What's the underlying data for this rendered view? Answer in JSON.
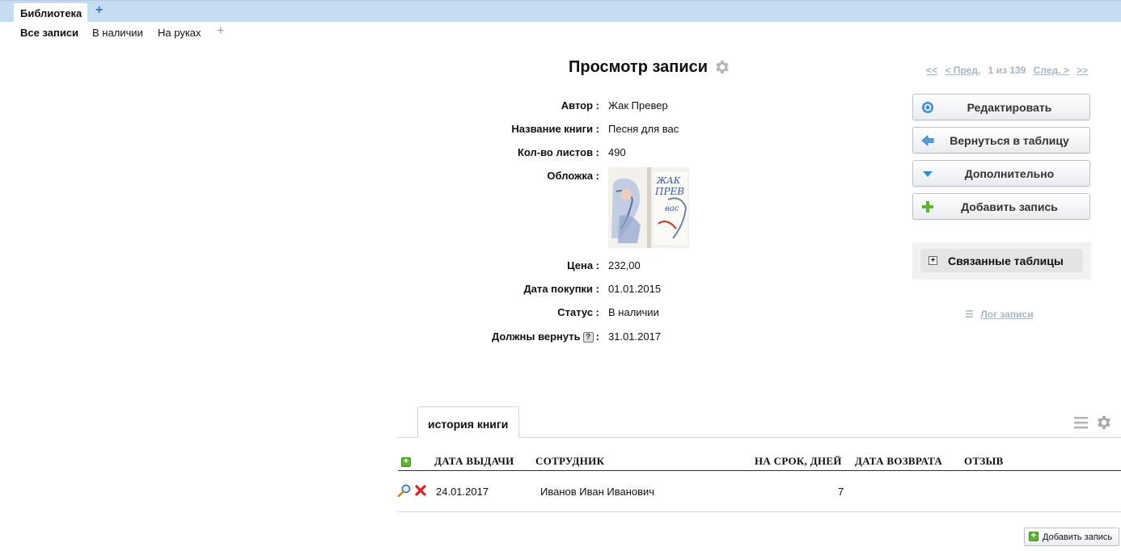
{
  "topbar": {
    "tab_label": "Библиотека",
    "add_label": "+"
  },
  "subnav": {
    "items": [
      "Все записи",
      "В наличии",
      "На руках"
    ],
    "add_label": "+"
  },
  "page": {
    "title": "Просмотр записи"
  },
  "pager": {
    "first": "<<",
    "prev": "< Пред.",
    "info": "1 из 139",
    "next": "След. >",
    "last": ">>"
  },
  "fields": [
    {
      "label": "Автор :",
      "value": "Жак Превер"
    },
    {
      "label": "Название книги :",
      "value": "Песня для вас"
    },
    {
      "label": "Кол-во листов :",
      "value": "490"
    },
    {
      "label": "Обложка :",
      "value": ""
    },
    {
      "label": "Цена :",
      "value": "232,00"
    },
    {
      "label": "Дата покупки :",
      "value": "01.01.2015"
    },
    {
      "label": "Статус :",
      "value": "В наличии"
    },
    {
      "label": "Должны вернуть",
      "suffix": ":",
      "help": "?",
      "value": "31.01.2017"
    }
  ],
  "cover": {
    "text_top": "ЖАК",
    "text_mid": "ПРЕВ",
    "text_bottom": "вас"
  },
  "actions": {
    "edit": "Редактировать",
    "back": "Вернуться в таблицу",
    "more": "Дополнительно",
    "add": "Добавить запись"
  },
  "related": {
    "label": "Связанные таблицы",
    "toggle": "+"
  },
  "log": {
    "label": "Лог записи"
  },
  "history": {
    "tab_label": "история книги",
    "columns": [
      "ДАТА ВЫДАЧИ",
      "СОТРУДНИК",
      "НА СРОК, ДНЕЙ",
      "ДАТА ВОЗВРАТА",
      "ОТЗЫВ"
    ],
    "rows": [
      {
        "issue_date": "24.01.2017",
        "employee": "Иванов Иван Иванович",
        "term_days": "7",
        "return_date": "",
        "review": ""
      }
    ],
    "add_label": "Добавить запись",
    "add_icon": "+"
  },
  "colors": {
    "accent": "#2d77c9",
    "topbar": "#c6dcf1",
    "muted_link": "#a8b6c4",
    "green": "#5cb531",
    "delete": "#d8261f"
  }
}
